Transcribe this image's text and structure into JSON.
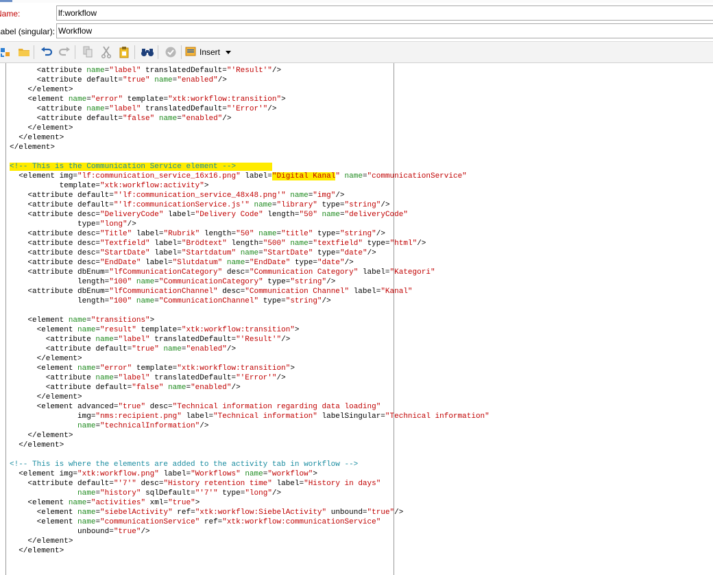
{
  "form": {
    "name_label": "Name:",
    "name_value": "lf:workflow",
    "label_singular_label": "Label (singular):",
    "label_singular_value": "Workflow"
  },
  "toolbar": {
    "insert_label": "Insert",
    "icons": [
      "refresh-icon",
      "open-folder-icon",
      "undo-icon",
      "redo-icon",
      "copy-icon",
      "cut-icon",
      "paste-icon",
      "find-icon",
      "validate-icon",
      "insert-icon",
      "dropdown-caret-icon"
    ]
  },
  "colors": {
    "tag": "#000000",
    "attribute_name": "#1e8a1e",
    "attribute_value": "#c00000",
    "comment": "#1a8ca0",
    "highlight": "#ffeb00",
    "required_label": "#c00000"
  },
  "editor": {
    "lines": [
      [
        [
          "t",
          "      <attribute "
        ],
        [
          "a",
          "name"
        ],
        [
          "t",
          "="
        ],
        [
          "v",
          "\"label\""
        ],
        [
          "t",
          " translatedDefault="
        ],
        [
          "v",
          "\"'Result'\""
        ],
        [
          "t",
          "/>"
        ]
      ],
      [
        [
          "t",
          "      <attribute default="
        ],
        [
          "v",
          "\"true\""
        ],
        [
          "t",
          " "
        ],
        [
          "a",
          "name"
        ],
        [
          "t",
          "="
        ],
        [
          "v",
          "\"enabled\""
        ],
        [
          "t",
          "/>"
        ]
      ],
      [
        [
          "t",
          "    </element>"
        ]
      ],
      [
        [
          "t",
          "    <element "
        ],
        [
          "a",
          "name"
        ],
        [
          "t",
          "="
        ],
        [
          "v",
          "\"error\""
        ],
        [
          "t",
          " template="
        ],
        [
          "v",
          "\"xtk:workflow:transition\""
        ],
        [
          "t",
          ">"
        ]
      ],
      [
        [
          "t",
          "      <attribute "
        ],
        [
          "a",
          "name"
        ],
        [
          "t",
          "="
        ],
        [
          "v",
          "\"label\""
        ],
        [
          "t",
          " translatedDefault="
        ],
        [
          "v",
          "\"'Error'\""
        ],
        [
          "t",
          "/>"
        ]
      ],
      [
        [
          "t",
          "      <attribute default="
        ],
        [
          "v",
          "\"false\""
        ],
        [
          "t",
          " "
        ],
        [
          "a",
          "name"
        ],
        [
          "t",
          "="
        ],
        [
          "v",
          "\"enabled\""
        ],
        [
          "t",
          "/>"
        ]
      ],
      [
        [
          "t",
          "    </element>"
        ]
      ],
      [
        [
          "t",
          "  </element>"
        ]
      ],
      [
        [
          "t",
          "</element>"
        ]
      ],
      [],
      [
        [
          "ch",
          "<!-- This is the Communication Service element -->"
        ],
        [
          "hl",
          "        "
        ]
      ],
      [
        [
          "t",
          "  <element img="
        ],
        [
          "v",
          "\"lf:communication_service_16x16.png\""
        ],
        [
          "t",
          " label="
        ],
        [
          "vh",
          "\"Digital Kanal"
        ],
        [
          "v",
          "\""
        ],
        [
          "t",
          " "
        ],
        [
          "a",
          "name"
        ],
        [
          "t",
          "="
        ],
        [
          "v",
          "\"communicationService\""
        ]
      ],
      [
        [
          "t",
          "           template="
        ],
        [
          "v",
          "\"xtk:workflow:activity\""
        ],
        [
          "t",
          ">"
        ]
      ],
      [
        [
          "t",
          "    <attribute default="
        ],
        [
          "v",
          "\"'lf:communication_service_48x48.png'\""
        ],
        [
          "t",
          " "
        ],
        [
          "a",
          "name"
        ],
        [
          "t",
          "="
        ],
        [
          "v",
          "\"img\""
        ],
        [
          "t",
          "/>"
        ]
      ],
      [
        [
          "t",
          "    <attribute default="
        ],
        [
          "v",
          "\"'lf:communicationService.js'\""
        ],
        [
          "t",
          " "
        ],
        [
          "a",
          "name"
        ],
        [
          "t",
          "="
        ],
        [
          "v",
          "\"library\""
        ],
        [
          "t",
          " type="
        ],
        [
          "v",
          "\"string\""
        ],
        [
          "t",
          "/>"
        ]
      ],
      [
        [
          "t",
          "    <attribute desc="
        ],
        [
          "v",
          "\"DeliveryCode\""
        ],
        [
          "t",
          " label="
        ],
        [
          "v",
          "\"Delivery Code\""
        ],
        [
          "t",
          " length="
        ],
        [
          "v",
          "\"50\""
        ],
        [
          "t",
          " "
        ],
        [
          "a",
          "name"
        ],
        [
          "t",
          "="
        ],
        [
          "v",
          "\"deliveryCode\""
        ]
      ],
      [
        [
          "t",
          "               type="
        ],
        [
          "v",
          "\"long\""
        ],
        [
          "t",
          "/>"
        ]
      ],
      [
        [
          "t",
          "    <attribute desc="
        ],
        [
          "v",
          "\"Title\""
        ],
        [
          "t",
          " label="
        ],
        [
          "v",
          "\"Rubrik\""
        ],
        [
          "t",
          " length="
        ],
        [
          "v",
          "\"50\""
        ],
        [
          "t",
          " "
        ],
        [
          "a",
          "name"
        ],
        [
          "t",
          "="
        ],
        [
          "v",
          "\"title\""
        ],
        [
          "t",
          " type="
        ],
        [
          "v",
          "\"string\""
        ],
        [
          "t",
          "/>"
        ]
      ],
      [
        [
          "t",
          "    <attribute desc="
        ],
        [
          "v",
          "\"Textfield\""
        ],
        [
          "t",
          " label="
        ],
        [
          "v",
          "\"Brödtext\""
        ],
        [
          "t",
          " length="
        ],
        [
          "v",
          "\"500\""
        ],
        [
          "t",
          " "
        ],
        [
          "a",
          "name"
        ],
        [
          "t",
          "="
        ],
        [
          "v",
          "\"textfield\""
        ],
        [
          "t",
          " type="
        ],
        [
          "v",
          "\"html\""
        ],
        [
          "t",
          "/>"
        ]
      ],
      [
        [
          "t",
          "    <attribute desc="
        ],
        [
          "v",
          "\"StartDate\""
        ],
        [
          "t",
          " label="
        ],
        [
          "v",
          "\"Startdatum\""
        ],
        [
          "t",
          " "
        ],
        [
          "a",
          "name"
        ],
        [
          "t",
          "="
        ],
        [
          "v",
          "\"StartDate\""
        ],
        [
          "t",
          " type="
        ],
        [
          "v",
          "\"date\""
        ],
        [
          "t",
          "/>"
        ]
      ],
      [
        [
          "t",
          "    <attribute desc="
        ],
        [
          "v",
          "\"EndDate\""
        ],
        [
          "t",
          " label="
        ],
        [
          "v",
          "\"Slutdatum\""
        ],
        [
          "t",
          " "
        ],
        [
          "a",
          "name"
        ],
        [
          "t",
          "="
        ],
        [
          "v",
          "\"EndDate\""
        ],
        [
          "t",
          " type="
        ],
        [
          "v",
          "\"date\""
        ],
        [
          "t",
          "/>"
        ]
      ],
      [
        [
          "t",
          "    <attribute dbEnum="
        ],
        [
          "v",
          "\"lfCommunicationCategory\""
        ],
        [
          "t",
          " desc="
        ],
        [
          "v",
          "\"Communication Category\""
        ],
        [
          "t",
          " label="
        ],
        [
          "v",
          "\"Kategori\""
        ]
      ],
      [
        [
          "t",
          "               length="
        ],
        [
          "v",
          "\"100\""
        ],
        [
          "t",
          " "
        ],
        [
          "a",
          "name"
        ],
        [
          "t",
          "="
        ],
        [
          "v",
          "\"CommunicationCategory\""
        ],
        [
          "t",
          " type="
        ],
        [
          "v",
          "\"string\""
        ],
        [
          "t",
          "/>"
        ]
      ],
      [
        [
          "t",
          "    <attribute dbEnum="
        ],
        [
          "v",
          "\"lfCommunicationChannel\""
        ],
        [
          "t",
          " desc="
        ],
        [
          "v",
          "\"Communication Channel\""
        ],
        [
          "t",
          " label="
        ],
        [
          "v",
          "\"Kanal\""
        ]
      ],
      [
        [
          "t",
          "               length="
        ],
        [
          "v",
          "\"100\""
        ],
        [
          "t",
          " "
        ],
        [
          "a",
          "name"
        ],
        [
          "t",
          "="
        ],
        [
          "v",
          "\"CommunicationChannel\""
        ],
        [
          "t",
          " type="
        ],
        [
          "v",
          "\"string\""
        ],
        [
          "t",
          "/>"
        ]
      ],
      [],
      [
        [
          "t",
          "    <element "
        ],
        [
          "a",
          "name"
        ],
        [
          "t",
          "="
        ],
        [
          "v",
          "\"transitions\""
        ],
        [
          "t",
          ">"
        ]
      ],
      [
        [
          "t",
          "      <element "
        ],
        [
          "a",
          "name"
        ],
        [
          "t",
          "="
        ],
        [
          "v",
          "\"result\""
        ],
        [
          "t",
          " template="
        ],
        [
          "v",
          "\"xtk:workflow:transition\""
        ],
        [
          "t",
          ">"
        ]
      ],
      [
        [
          "t",
          "        <attribute "
        ],
        [
          "a",
          "name"
        ],
        [
          "t",
          "="
        ],
        [
          "v",
          "\"label\""
        ],
        [
          "t",
          " translatedDefault="
        ],
        [
          "v",
          "\"'Result'\""
        ],
        [
          "t",
          "/>"
        ]
      ],
      [
        [
          "t",
          "        <attribute default="
        ],
        [
          "v",
          "\"true\""
        ],
        [
          "t",
          " "
        ],
        [
          "a",
          "name"
        ],
        [
          "t",
          "="
        ],
        [
          "v",
          "\"enabled\""
        ],
        [
          "t",
          "/>"
        ]
      ],
      [
        [
          "t",
          "      </element>"
        ]
      ],
      [
        [
          "t",
          "      <element "
        ],
        [
          "a",
          "name"
        ],
        [
          "t",
          "="
        ],
        [
          "v",
          "\"error\""
        ],
        [
          "t",
          " template="
        ],
        [
          "v",
          "\"xtk:workflow:transition\""
        ],
        [
          "t",
          ">"
        ]
      ],
      [
        [
          "t",
          "        <attribute "
        ],
        [
          "a",
          "name"
        ],
        [
          "t",
          "="
        ],
        [
          "v",
          "\"label\""
        ],
        [
          "t",
          " translatedDefault="
        ],
        [
          "v",
          "\"'Error'\""
        ],
        [
          "t",
          "/>"
        ]
      ],
      [
        [
          "t",
          "        <attribute default="
        ],
        [
          "v",
          "\"false\""
        ],
        [
          "t",
          " "
        ],
        [
          "a",
          "name"
        ],
        [
          "t",
          "="
        ],
        [
          "v",
          "\"enabled\""
        ],
        [
          "t",
          "/>"
        ]
      ],
      [
        [
          "t",
          "      </element>"
        ]
      ],
      [
        [
          "t",
          "      <element advanced="
        ],
        [
          "v",
          "\"true\""
        ],
        [
          "t",
          " desc="
        ],
        [
          "v",
          "\"Technical information regarding data loading\""
        ]
      ],
      [
        [
          "t",
          "               img="
        ],
        [
          "v",
          "\"nms:recipient.png\""
        ],
        [
          "t",
          " label="
        ],
        [
          "v",
          "\"Technical information\""
        ],
        [
          "t",
          " labelSingular="
        ],
        [
          "v",
          "\"Technical information\""
        ]
      ],
      [
        [
          "t",
          "               "
        ],
        [
          "a",
          "name"
        ],
        [
          "t",
          "="
        ],
        [
          "v",
          "\"technicalInformation\""
        ],
        [
          "t",
          "/>"
        ]
      ],
      [
        [
          "t",
          "    </element>"
        ]
      ],
      [
        [
          "t",
          "  </element>"
        ]
      ],
      [],
      [
        [
          "c",
          "<!-- This is where the elements are added to the activity tab in workflow -->"
        ]
      ],
      [
        [
          "t",
          "  <element img="
        ],
        [
          "v",
          "\"xtk:workflow.png\""
        ],
        [
          "t",
          " label="
        ],
        [
          "v",
          "\"Workflows\""
        ],
        [
          "t",
          " "
        ],
        [
          "a",
          "name"
        ],
        [
          "t",
          "="
        ],
        [
          "v",
          "\"workflow\""
        ],
        [
          "t",
          ">"
        ]
      ],
      [
        [
          "t",
          "    <attribute default="
        ],
        [
          "v",
          "\"'7'\""
        ],
        [
          "t",
          " desc="
        ],
        [
          "v",
          "\"History retention time\""
        ],
        [
          "t",
          " label="
        ],
        [
          "v",
          "\"History in days\""
        ]
      ],
      [
        [
          "t",
          "               "
        ],
        [
          "a",
          "name"
        ],
        [
          "t",
          "="
        ],
        [
          "v",
          "\"history\""
        ],
        [
          "t",
          " sqlDefault="
        ],
        [
          "v",
          "\"'7'\""
        ],
        [
          "t",
          " type="
        ],
        [
          "v",
          "\"long\""
        ],
        [
          "t",
          "/>"
        ]
      ],
      [
        [
          "t",
          "    <element "
        ],
        [
          "a",
          "name"
        ],
        [
          "t",
          "="
        ],
        [
          "v",
          "\"activities\""
        ],
        [
          "t",
          " xml="
        ],
        [
          "v",
          "\"true\""
        ],
        [
          "t",
          ">"
        ]
      ],
      [
        [
          "t",
          "      <element "
        ],
        [
          "a",
          "name"
        ],
        [
          "t",
          "="
        ],
        [
          "v",
          "\"siebelActivity\""
        ],
        [
          "t",
          " ref="
        ],
        [
          "v",
          "\"xtk:workflow:SiebelActivity\""
        ],
        [
          "t",
          " unbound="
        ],
        [
          "v",
          "\"true\""
        ],
        [
          "t",
          "/>"
        ]
      ],
      [
        [
          "t",
          "      <element "
        ],
        [
          "a",
          "name"
        ],
        [
          "t",
          "="
        ],
        [
          "v",
          "\"communicationService\""
        ],
        [
          "t",
          " ref="
        ],
        [
          "v",
          "\"xtk:workflow:communicationService\""
        ]
      ],
      [
        [
          "t",
          "               unbound="
        ],
        [
          "v",
          "\"true\""
        ],
        [
          "t",
          "/>"
        ]
      ],
      [
        [
          "t",
          "    </element>"
        ]
      ],
      [
        [
          "t",
          "  </element>"
        ]
      ]
    ]
  }
}
